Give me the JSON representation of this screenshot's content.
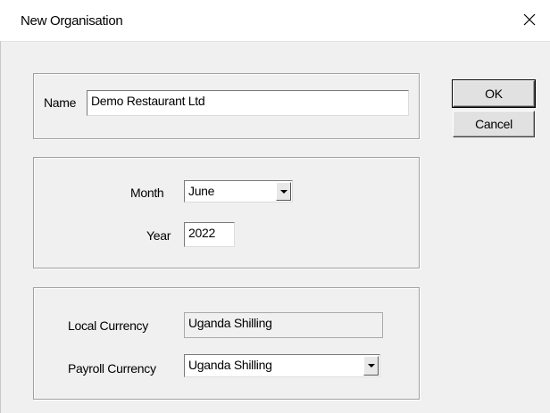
{
  "window": {
    "title": "New Organisation",
    "close_icon": "close-icon"
  },
  "name_section": {
    "label": "Name",
    "value": "Demo Restaurant Ltd"
  },
  "period_section": {
    "month_label": "Month",
    "month_value": "June",
    "year_label": "Year",
    "year_value": "2022"
  },
  "currency_section": {
    "local_label": "Local Currency",
    "local_value": "Uganda Shilling",
    "payroll_label": "Payroll Currency",
    "payroll_value": "Uganda Shilling"
  },
  "buttons": {
    "ok": "OK",
    "cancel": "Cancel"
  }
}
